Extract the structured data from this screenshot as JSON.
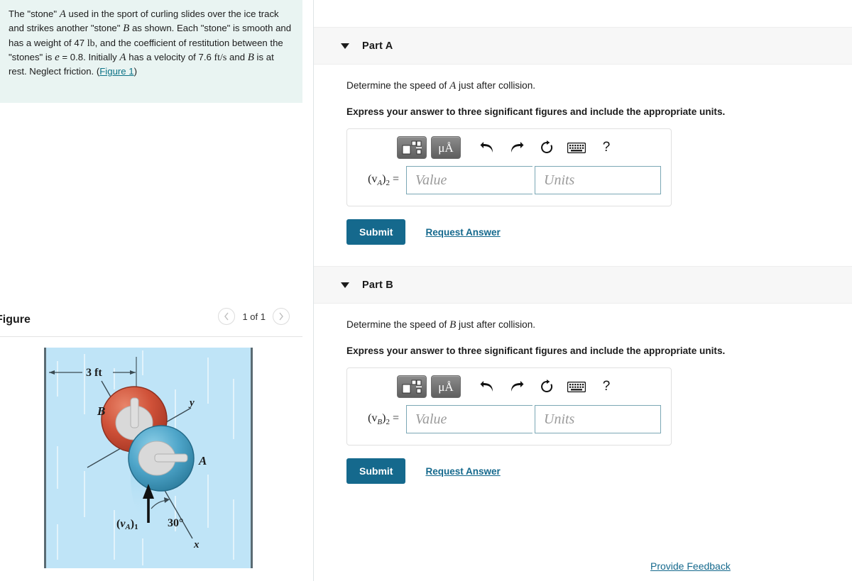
{
  "problem": {
    "sentences": {
      "s1_pre": "The \"stone\" ",
      "s1_a": "A",
      "s1_post": " used in the sport of curling slides over the ice track and strikes another \"stone\" ",
      "s1_b": "B",
      "s1_end": " as shown. Each \"stone\" is smooth and has a weight of 47 ",
      "weight_unit": "lb",
      "s2": ", and the coefficient of restitution between the \"stones\" is ",
      "e_sym": "e",
      "e_val": " = 0.8. Initially ",
      "a_sym": "A",
      "s3": " has a velocity of 7.6 ",
      "vel_unit": "ft/s",
      "s4": " and ",
      "b_sym": "B",
      "s5": " is at rest. Neglect friction. (",
      "figure_link": "Figure 1",
      "s6": ")"
    }
  },
  "figure_panel": {
    "title": "Figure",
    "prev_icon": "chevron-left-icon",
    "next_icon": "chevron-right-icon",
    "counter": "1 of 1",
    "diagram": {
      "dimension_label": "3 ft",
      "stone_b_label": "B",
      "stone_a_label": "A",
      "axis_y_label": "y",
      "axis_x_label": "x",
      "velocity_label_pre": "(v",
      "velocity_label_sub_a": "A",
      "velocity_label_mid": ")",
      "velocity_label_sub_1": "1",
      "angle_label": "30°",
      "colors": {
        "ice": "#bfe4f7",
        "stone_a": "#4da3c7",
        "stone_b": "#cf5138",
        "handle": "#d8d8d8",
        "wall": "#5a6b73"
      }
    }
  },
  "parts": [
    {
      "caret_icon": "caret-down-icon",
      "label": "Part A",
      "prompt_pre": "Determine the speed of ",
      "prompt_sym": "A",
      "prompt_post": " just after collision.",
      "instruction": "Express your answer to three significant figures and include the appropriate units.",
      "toolbar": {
        "math_template_icon": "math-template-icon",
        "units_button_label": "μÅ",
        "undo_icon": "undo-icon",
        "redo_icon": "redo-icon",
        "reset_icon": "reset-icon",
        "keyboard_icon": "keyboard-icon",
        "help_icon": "?"
      },
      "answer_label_pre": "(v",
      "answer_label_sub": "A",
      "answer_label_post": ")",
      "answer_label_sub2": "2",
      "answer_label_eq": " =",
      "value_placeholder": "Value",
      "value_current": "",
      "units_placeholder": "Units",
      "units_current": "",
      "submit_label": "Submit",
      "request_label": "Request Answer"
    },
    {
      "caret_icon": "caret-down-icon",
      "label": "Part B",
      "prompt_pre": "Determine the speed of ",
      "prompt_sym": "B",
      "prompt_post": " just after collision.",
      "instruction": "Express your answer to three significant figures and include the appropriate units.",
      "toolbar": {
        "math_template_icon": "math-template-icon",
        "units_button_label": "μÅ",
        "undo_icon": "undo-icon",
        "redo_icon": "redo-icon",
        "reset_icon": "reset-icon",
        "keyboard_icon": "keyboard-icon",
        "help_icon": "?"
      },
      "answer_label_pre": "(v",
      "answer_label_sub": "B",
      "answer_label_post": ")",
      "answer_label_sub2": "2",
      "answer_label_eq": " =",
      "value_placeholder": "Value",
      "value_current": "",
      "units_placeholder": "Units",
      "units_current": "",
      "submit_label": "Submit",
      "request_label": "Request Answer"
    }
  ],
  "footer": {
    "feedback_label": "Provide Feedback"
  },
  "colors": {
    "accent": "#15698d",
    "problem_bg": "#e9f4f2",
    "part_header_bg": "#f7f7f7"
  }
}
